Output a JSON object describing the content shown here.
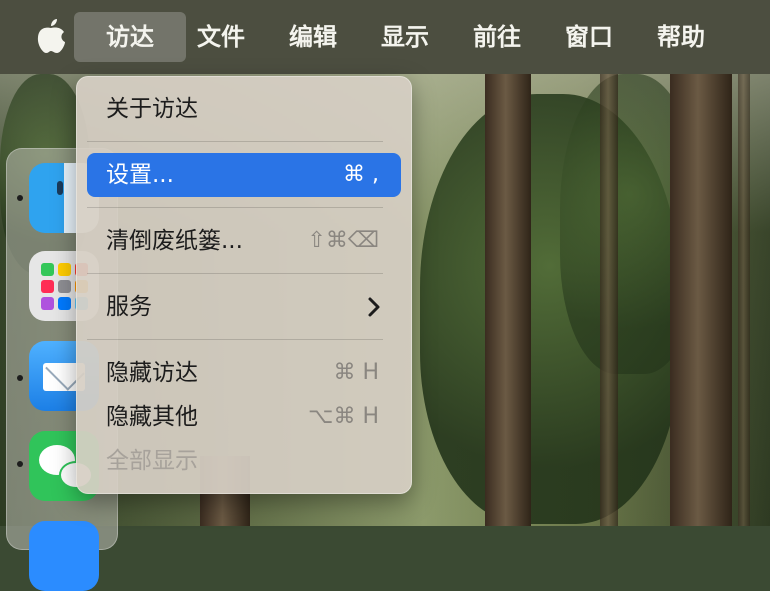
{
  "menubar": {
    "items": [
      {
        "label": "访达",
        "active": true
      },
      {
        "label": "文件"
      },
      {
        "label": "编辑"
      },
      {
        "label": "显示"
      },
      {
        "label": "前往"
      },
      {
        "label": "窗口"
      },
      {
        "label": "帮助"
      }
    ]
  },
  "dropdown": {
    "about": "关于访达",
    "settings": {
      "label": "设置...",
      "shortcut": "⌘ ,"
    },
    "empty_trash": {
      "label": "清倒废纸篓...",
      "shortcut": "⇧⌘⌫"
    },
    "services": {
      "label": "服务",
      "submenu_icon": "chevron-right-icon"
    },
    "hide_finder": {
      "label": "隐藏访达",
      "shortcut": "⌘ H"
    },
    "hide_others": {
      "label": "隐藏其他",
      "shortcut": "⌥⌘ H"
    },
    "show_all": {
      "label": "全部显示",
      "disabled": true
    }
  },
  "dock": {
    "apps": [
      "finder-icon",
      "launchpad-icon",
      "mail-icon",
      "wechat-icon"
    ]
  },
  "colors": {
    "highlight": "#2a74e6",
    "menubar": "#4c4e40"
  }
}
